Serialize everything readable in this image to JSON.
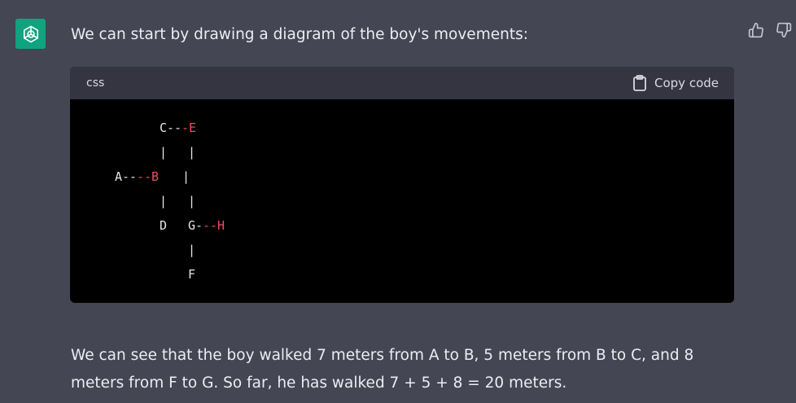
{
  "message": {
    "intro": "We can start by drawing a diagram of the boy's movements:",
    "response_line1": "We can see that the boy walked 7 meters from A to B, 5 meters from B to C, and 8",
    "response_line2": "meters from F to G. So far, he has walked 7 + 5 + 8 = 20 meters."
  },
  "code_block": {
    "language": "css",
    "copy_label": "Copy code",
    "diagram": {
      "row1_left": "C--",
      "row1_right": "-E",
      "row2_a": "|",
      "row2_b": "|",
      "row3_left": "A--",
      "row3_right": "--B",
      "row3_bar": "|",
      "row4_a": "|",
      "row4_b": "|",
      "row5_d": "D",
      "row5_g": "G-",
      "row5_right": "--H",
      "row6_bar": "|",
      "row7_f": "F"
    }
  },
  "icons": {
    "avatar": "openai-logo-icon",
    "thumbs_up": "thumbs-up-icon",
    "thumbs_down": "thumbs-down-icon",
    "copy": "clipboard-icon"
  },
  "colors": {
    "background": "#444654",
    "avatar": "#10a37f",
    "code_header": "#343541",
    "code_body": "#000000",
    "highlight": "#ef4b63"
  }
}
